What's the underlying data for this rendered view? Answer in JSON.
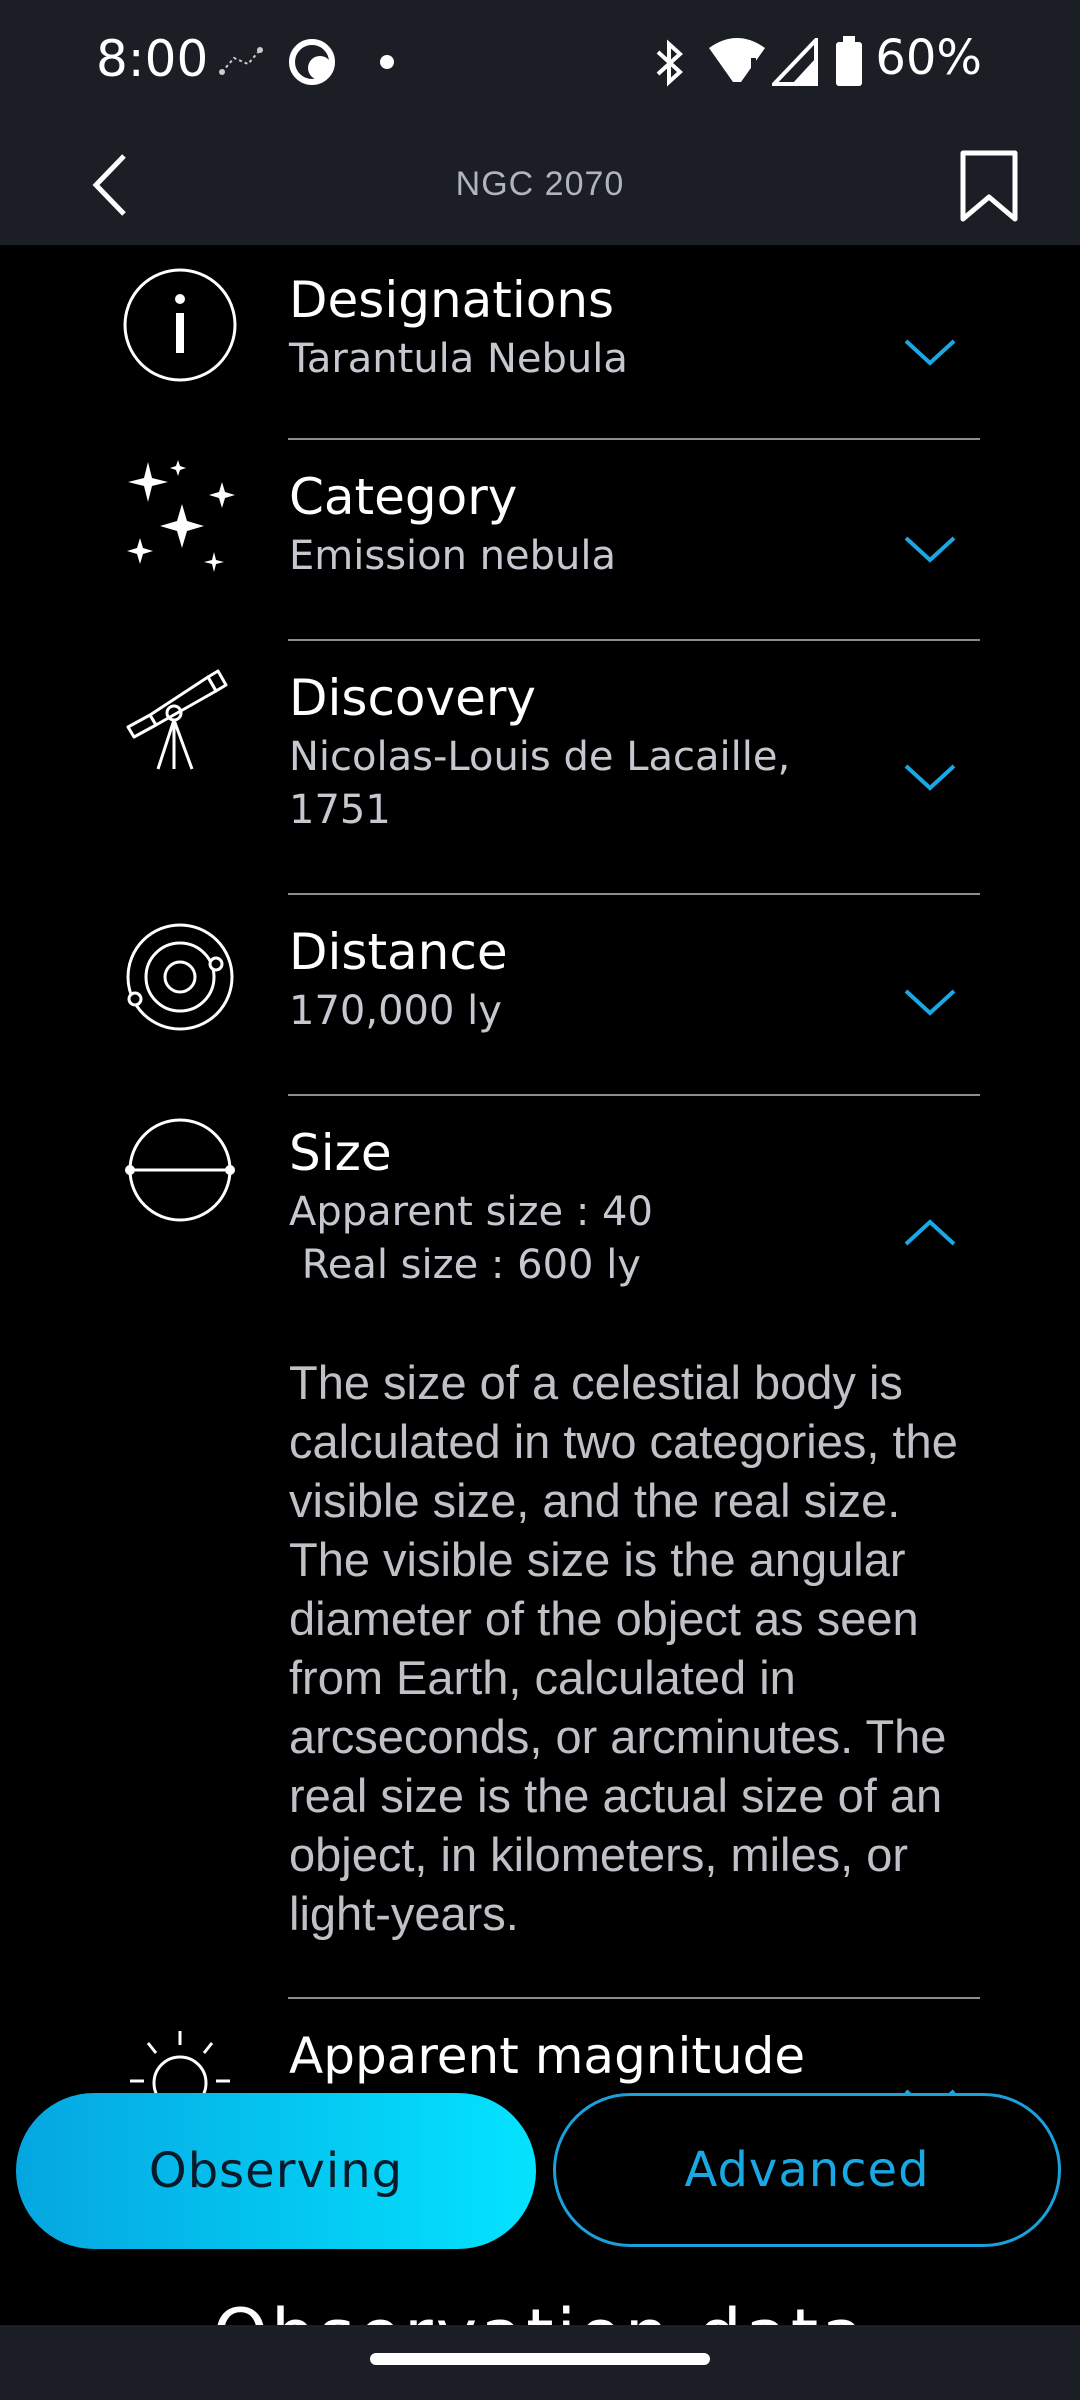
{
  "status": {
    "time": "8:00",
    "battery": "60%"
  },
  "appbar": {
    "title": "NGC 2070"
  },
  "rows": [
    {
      "title": "Designations",
      "sub": "Tarantula Nebula",
      "icon": "info-icon",
      "expanded": false
    },
    {
      "title": "Category",
      "sub": "Emission nebula",
      "icon": "sparkles-icon",
      "expanded": false
    },
    {
      "title": "Discovery",
      "sub": "Nicolas-Louis de Lacaille,",
      "sub2": "1751",
      "icon": "telescope-icon",
      "expanded": false
    },
    {
      "title": "Distance",
      "sub": "170,000 ly",
      "icon": "orbit-icon",
      "expanded": false
    },
    {
      "title": "Size",
      "sub": "Apparent size : 40",
      "sub2": " Real size : 600 ly",
      "icon": "sphere-icon",
      "expanded": true
    },
    {
      "title": "Apparent magnitude",
      "icon": "sun-icon",
      "expanded": false
    }
  ],
  "size_description": "The size of a celestial body is calculated in two categories, the visible size, and the real size. The visible size is the angular diameter of the object as seen from Earth, calculated in arcseconds, or arcminutes. The real size is the actual size of an object, in kilometers, miles, or light-years.",
  "buttons": {
    "observing": "Observing",
    "advanced": "Advanced"
  },
  "section": {
    "observation_heading": "Observation data"
  },
  "colors": {
    "accent": "#1aa8e4",
    "bar_bg": "#1b1e25"
  }
}
